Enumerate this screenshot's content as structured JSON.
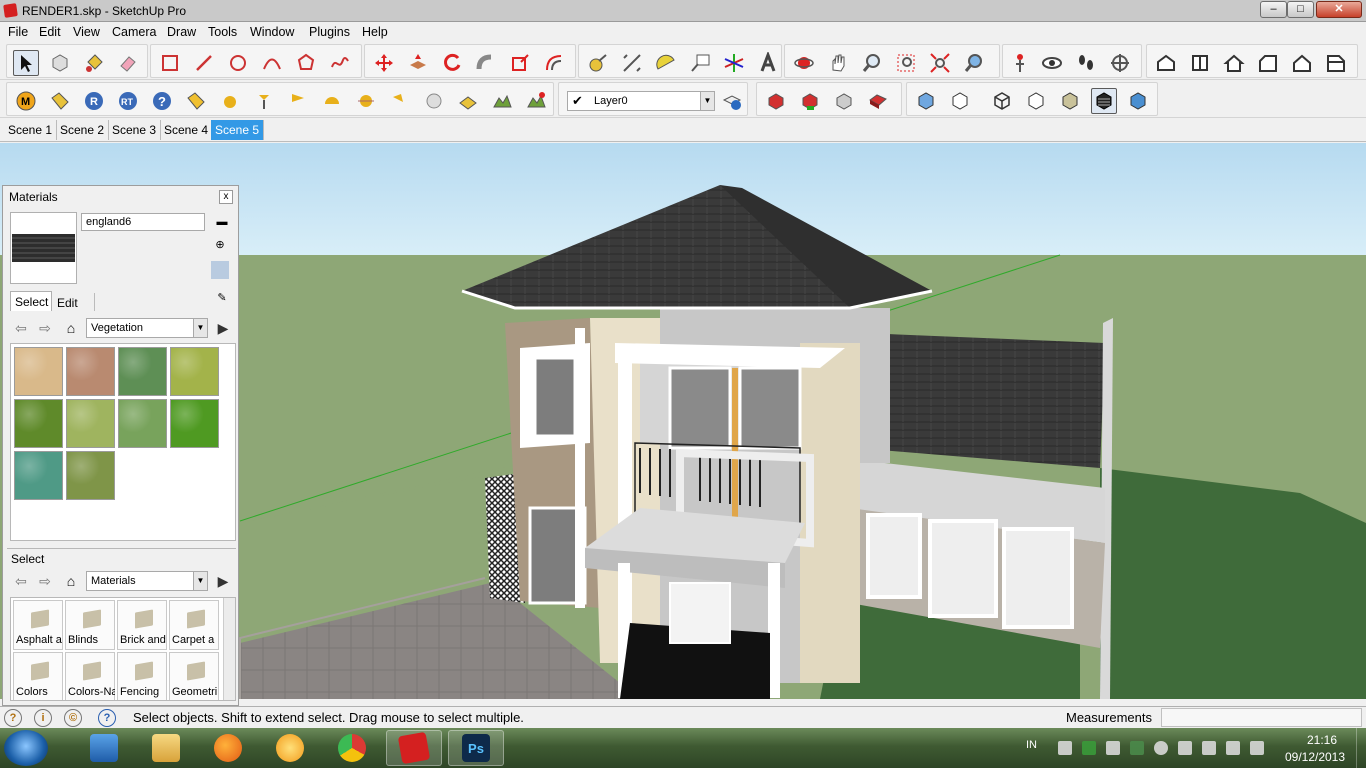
{
  "window": {
    "title": "RENDER1.skp - SketchUp Pro",
    "min_label": "–",
    "max_label": "□",
    "close_label": "✕"
  },
  "menu": [
    "File",
    "Edit",
    "View",
    "Camera",
    "Draw",
    "Tools",
    "Window",
    "Plugins",
    "Help"
  ],
  "layer": {
    "check": "✔",
    "name": "Layer0"
  },
  "scenes": [
    "Scene 1",
    "Scene 2",
    "Scene 3",
    "Scene 4",
    "Scene 5"
  ],
  "active_scene": "Scene 5",
  "materials": {
    "title": "Materials",
    "close": "x",
    "current_name": "england6",
    "tab_select": "Select",
    "tab_edit": "Edit",
    "collection": "Vegetation",
    "select_header": "Select",
    "library": "Materials",
    "folders": [
      "Asphalt a",
      "Blinds",
      "Brick and",
      "Carpet a",
      "Colors",
      "Colors-Na",
      "Fencing",
      "Geometri"
    ],
    "textures": [
      "#d9b98a",
      "#b98a70",
      "#5e8f55",
      "#a3b34a",
      "#5f8a2a",
      "#9fb45f",
      "#78a35c",
      "#4f9a22",
      "#4f9a86",
      "#7f9548"
    ]
  },
  "status": {
    "text": "Select objects. Shift to extend select. Drag mouse to select multiple.",
    "measurements_label": "Measurements",
    "measurements_value": ""
  },
  "taskbar": {
    "lang": "IN",
    "time": "21:16",
    "date": "09/12/2013"
  },
  "colors": {
    "sky": "#c5e2f3",
    "grass": "#8ea776",
    "roof": "#3a3a3a",
    "accent_blue": "#3399e6"
  }
}
